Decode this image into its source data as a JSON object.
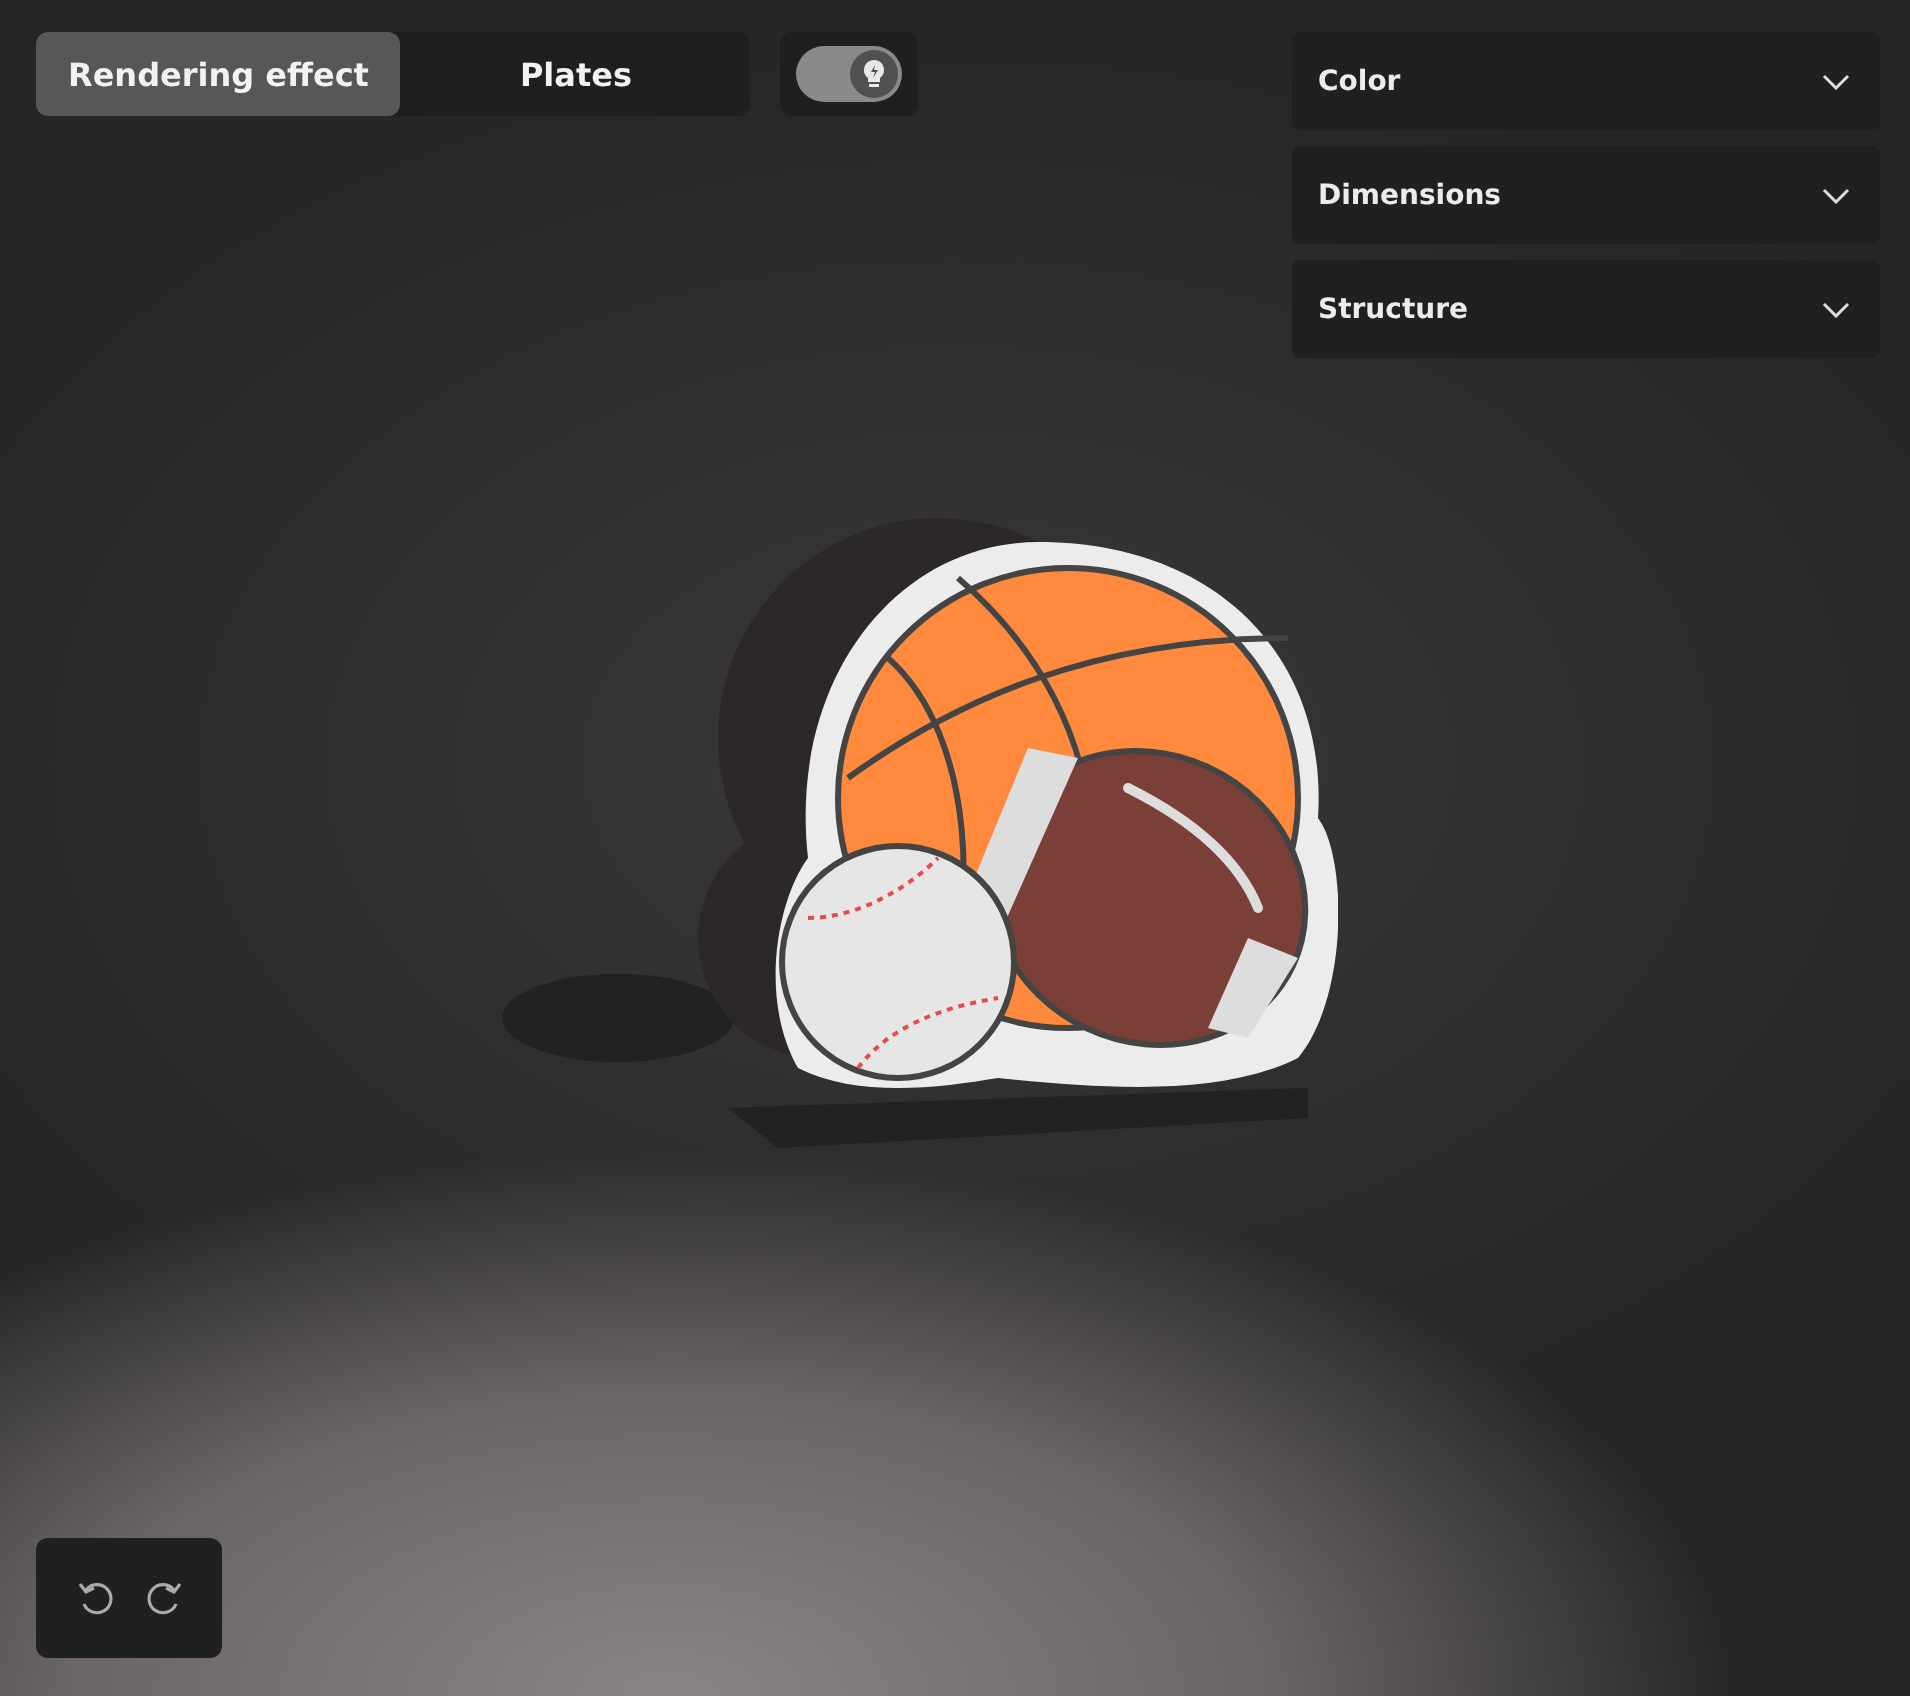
{
  "view_tabs": [
    {
      "label": "Rendering effect",
      "selected": true
    },
    {
      "label": "Plates",
      "selected": false
    }
  ],
  "light_toggle": {
    "on": true
  },
  "panels": [
    {
      "title": "Color",
      "expanded": false
    },
    {
      "title": "Dimensions",
      "expanded": false
    },
    {
      "title": "Structure",
      "expanded": false
    }
  ]
}
